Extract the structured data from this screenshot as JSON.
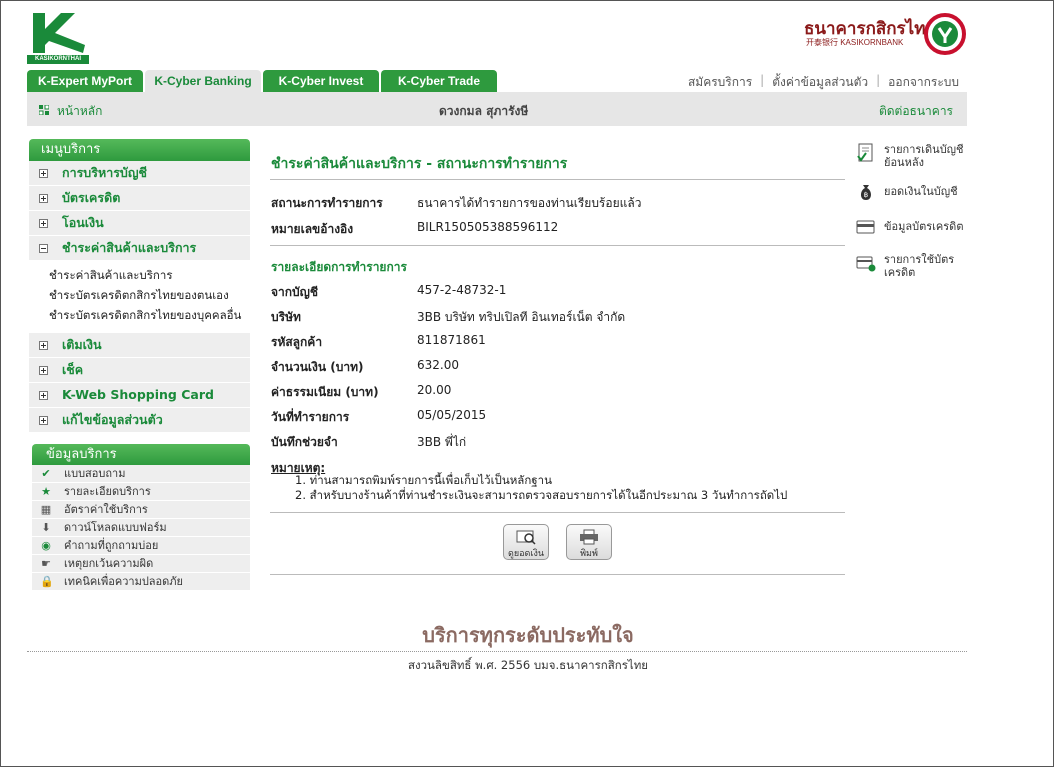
{
  "header": {
    "logo_text": "KASIKORNTHAI",
    "bank_name_th": "ธนาคารกสิกรไทย",
    "bank_name_cn_en": "开泰银行 KASIKORNBANK",
    "tabs": [
      {
        "label": "K-Expert MyPort",
        "active": false
      },
      {
        "label": "K-Cyber Banking",
        "active": true
      },
      {
        "label": "K-Cyber Invest",
        "active": false
      },
      {
        "label": "K-Cyber Trade",
        "active": false
      }
    ],
    "links": [
      "สมัครบริการ",
      "ตั้งค่าข้อมูลส่วนตัว",
      "ออกจากระบบ"
    ],
    "home": "หน้าหลัก",
    "user": "ดวงกมล สุภารังษี",
    "contact": "ติดต่อธนาคาร"
  },
  "menu": {
    "title": "เมนูบริการ",
    "items_top": [
      "การบริหารบัญชี",
      "บัตรเครดิต",
      "โอนเงิน",
      "ชำระค่าสินค้าและบริการ"
    ],
    "sub_items": [
      "ชำระค่าสินค้าและบริการ",
      "ชำระบัตรเครดิตกสิกรไทยของตนเอง",
      "ชำระบัตรเครดิตกสิกรไทยของบุคคลอื่น"
    ],
    "items_bottom": [
      "เติมเงิน",
      "เช็ค",
      "K-Web Shopping Card",
      "แก้ไขข้อมูลส่วนตัว"
    ]
  },
  "info": {
    "title": "ข้อมูลบริการ",
    "items": [
      "แบบสอบถาม",
      "รายละเอียดบริการ",
      "อัตราค่าใช้บริการ",
      "ดาวน์โหลดแบบฟอร์ม",
      "คำถามที่ถูกถามบ่อย",
      "เหตุยกเว้นความผิด",
      "เทคนิคเพื่อความปลอดภัย"
    ]
  },
  "content": {
    "title": "ชำระค่าสินค้าและบริการ - สถานะการทำรายการ",
    "status_label": "สถานะการทำรายการ",
    "status_value": "ธนาคารได้ทำรายการของท่านเรียบร้อยแล้ว",
    "ref_label": "หมายเลขอ้างอิง",
    "ref_value": "BILR150505388596112",
    "section": "รายละเอียดการทำรายการ",
    "details": [
      {
        "label": "จากบัญชี",
        "value": "457-2-48732-1"
      },
      {
        "label": "บริษัท",
        "value": "3BB บริษัท ทริปเปิลที อินเทอร์เน็ต จำกัด"
      },
      {
        "label": "รหัสลูกค้า",
        "value": "811871861"
      },
      {
        "label": "จำนวนเงิน (บาท)",
        "value": "632.00"
      },
      {
        "label": "ค่าธรรมเนียม (บาท)",
        "value": "20.00"
      },
      {
        "label": "วันที่ทำรายการ",
        "value": "05/05/2015"
      },
      {
        "label": "บันทึกช่วยจำ",
        "value": "3BB พี่ไก่"
      }
    ],
    "note_title": "หมายเหตุ:",
    "notes": [
      "1. ท่านสามารถพิมพ์รายการนี้เพื่อเก็บไว้เป็นหลักฐาน",
      "2. สำหรับบางร้านค้าที่ท่านชำระเงินจะสามารถตรวจสอบรายการได้ในอีกประมาณ 3 วันทำการถัดไป"
    ],
    "btn_balance": "ดูยอดเงิน",
    "btn_print": "พิมพ์"
  },
  "quick_links": [
    "รายการเดินบัญชีย้อนหลัง",
    "ยอดเงินในบัญชี",
    "ข้อมูลบัตรเครดิต",
    "รายการใช้บัตรเครดิต"
  ],
  "footer": {
    "slogan": "บริการทุกระดับประทับใจ",
    "copyright": "สงวนลิขสิทธิ์ พ.ศ. 2556 บมจ.ธนาคารกสิกรไทย"
  }
}
